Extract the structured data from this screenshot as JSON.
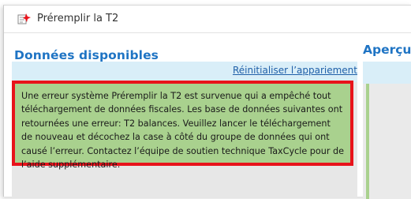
{
  "window": {
    "title": "Préremplir la T2",
    "icon": "prefill-app-icon"
  },
  "left_panel": {
    "heading": "Données disponibles",
    "reset_link": "Réinitialiser l’appariement",
    "error_message": "Une erreur système Préremplir la T2 est survenue qui a empêché tout téléchargement de données fiscales. Les base de données suivantes ont retournées une erreur: T2 balances. Veuillez lancer le téléchargement de nouveau et décochez la case à côté du groupe de données qui ont causé l’erreur. Contactez l’équipe de soutien technique TaxCycle pour de l’aide supplémentaire."
  },
  "right_panel": {
    "heading": "Aperçu"
  },
  "colors": {
    "heading": "#1f74c4",
    "link": "#1f5fa8",
    "highlight_border": "#e8131b",
    "message_bg": "#a9d18e",
    "band_bg": "#d9eef8"
  }
}
